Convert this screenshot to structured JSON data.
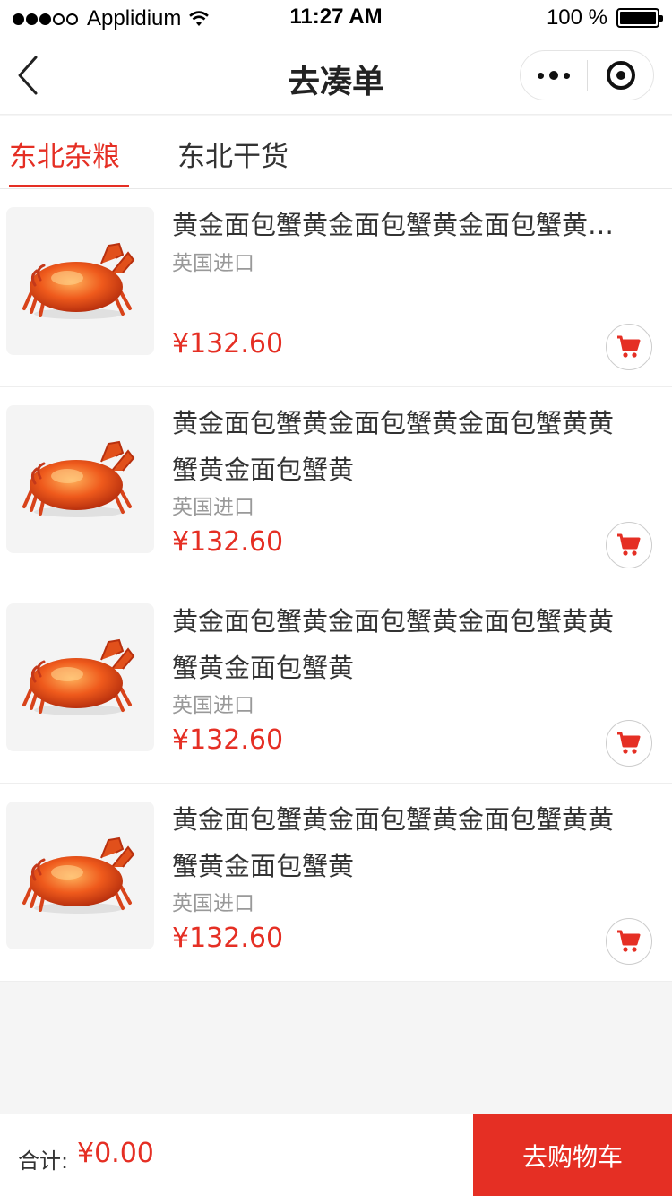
{
  "status": {
    "carrier": "Applidium",
    "time": "11:27 AM",
    "battery": "100 %"
  },
  "nav": {
    "title": "去凑单"
  },
  "tabs": [
    "东北杂粮",
    "东北干货"
  ],
  "products": [
    {
      "name": "黄金面包蟹黄金面包蟹黄金面包蟹黄金面包蟹黄",
      "origin": "英国进口",
      "price": "¥132.60"
    },
    {
      "name": "黄金面包蟹黄金面包蟹黄金面包蟹黄黄蟹黄金面包蟹黄",
      "origin": "英国进口",
      "price": "¥132.60"
    },
    {
      "name": "黄金面包蟹黄金面包蟹黄金面包蟹黄黄蟹黄金面包蟹黄",
      "origin": "英国进口",
      "price": "¥132.60"
    },
    {
      "name": "黄金面包蟹黄金面包蟹黄金面包蟹黄黄蟹黄金面包蟹黄",
      "origin": "英国进口",
      "price": "¥132.60"
    }
  ],
  "footer": {
    "total_label": "合计:",
    "total_value": "¥0.00",
    "checkout_label": "去购物车"
  },
  "colors": {
    "accent": "#e52f24",
    "background": "#f5f5f5"
  },
  "icons": {
    "back": "chevron-left-icon",
    "more": "more-dots-icon",
    "close": "target-icon",
    "cart": "cart-icon",
    "thumb": "crab-image"
  }
}
